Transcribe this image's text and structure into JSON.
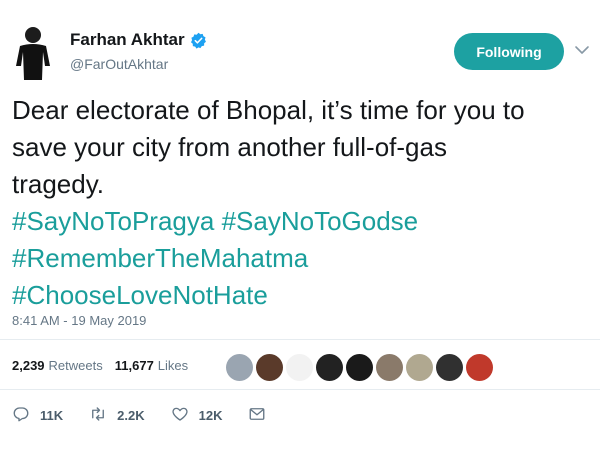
{
  "author": {
    "display_name": "Farhan Akhtar",
    "handle": "@FarOutAkhtar",
    "verified": true
  },
  "follow_button": {
    "label": "Following",
    "color": "#1da1a2"
  },
  "tweet": {
    "lines": [
      [
        {
          "t": "Dear electorate of Bhopal, it’s time for you to",
          "tag": false
        }
      ],
      [
        {
          "t": "save your city from another full-of-gas",
          "tag": false
        }
      ],
      [
        {
          "t": "tragedy.",
          "tag": false
        }
      ],
      [
        {
          "t": "#SayNoToPragya",
          "tag": true
        },
        {
          "t": " ",
          "tag": false
        },
        {
          "t": "#SayNoToGodse",
          "tag": true
        }
      ],
      [
        {
          "t": "#RememberTheMahatma",
          "tag": true
        }
      ],
      [
        {
          "t": "#ChooseLoveNotHate",
          "tag": true
        }
      ]
    ],
    "hashtag_color": "#1a9e9b",
    "timestamp": "8:41 AM - 19 May 2019"
  },
  "stats": {
    "retweets_count": "2,239",
    "retweets_label": "Retweets",
    "likes_count": "11,677",
    "likes_label": "Likes"
  },
  "likers": [
    {
      "name": "liker-1",
      "color": "#9aa5b1"
    },
    {
      "name": "liker-2",
      "color": "#5a3a2a"
    },
    {
      "name": "liker-3",
      "color": "#f2f2f2"
    },
    {
      "name": "liker-4",
      "color": "#222222"
    },
    {
      "name": "liker-5",
      "color": "#1a1a1a"
    },
    {
      "name": "liker-6",
      "color": "#8a7a6a"
    },
    {
      "name": "liker-7",
      "color": "#b0a890"
    },
    {
      "name": "liker-8",
      "color": "#303030"
    },
    {
      "name": "liker-9",
      "color": "#c0392b"
    }
  ],
  "actions": {
    "replies": "11K",
    "retweets": "2.2K",
    "likes": "12K"
  },
  "icons": {
    "verified": "verified-badge-icon",
    "chevron": "chevron-down-icon",
    "reply": "reply-icon",
    "retweet": "retweet-icon",
    "like": "heart-icon",
    "dm": "envelope-icon"
  }
}
